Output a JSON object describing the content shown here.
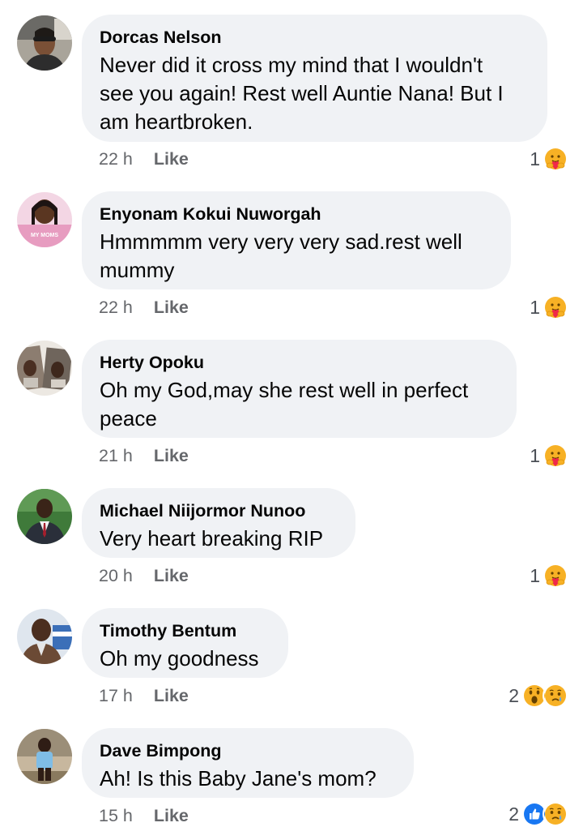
{
  "comments": [
    {
      "author": "Dorcas Nelson",
      "text": "Never did it cross my mind that I wouldn't\nsee you again! Rest well Auntie Nana! But I\nam heartbroken.",
      "time": "22 h",
      "like_label": "Like",
      "reaction_count": "1",
      "reactions": [
        "care"
      ]
    },
    {
      "author": "Enyonam Kokui Nuworgah",
      "text": "Hmmmmm very very very sad.rest well\nmummy",
      "time": "22 h",
      "like_label": "Like",
      "reaction_count": "1",
      "reactions": [
        "care"
      ]
    },
    {
      "author": "Herty Opoku",
      "text": "Oh my God,may she rest well in perfect\npeace",
      "time": "21 h",
      "like_label": "Like",
      "reaction_count": "1",
      "reactions": [
        "care"
      ]
    },
    {
      "author": "Michael Niijormor Nunoo",
      "text": "Very heart breaking RIP",
      "time": "20 h",
      "like_label": "Like",
      "reaction_count": "1",
      "reactions": [
        "care"
      ]
    },
    {
      "author": "Timothy Bentum",
      "text": "Oh my goodness",
      "time": "17 h",
      "like_label": "Like",
      "reaction_count": "2",
      "reactions": [
        "wow",
        "sad"
      ]
    },
    {
      "author": "Dave Bimpong",
      "text": "Ah! Is this Baby Jane's mom?",
      "time": "15 h",
      "like_label": "Like",
      "reaction_count": "2",
      "reactions": [
        "like",
        "sad"
      ]
    }
  ],
  "avatar_texts": {
    "enyonam_logo": "MY MOMS"
  },
  "colors": {
    "bubble": "#f0f2f5",
    "meta_text": "#65676b",
    "like_blue": "#1877f2",
    "emoji_yellow": "#f7b125",
    "care_heart": "#f0284a"
  }
}
